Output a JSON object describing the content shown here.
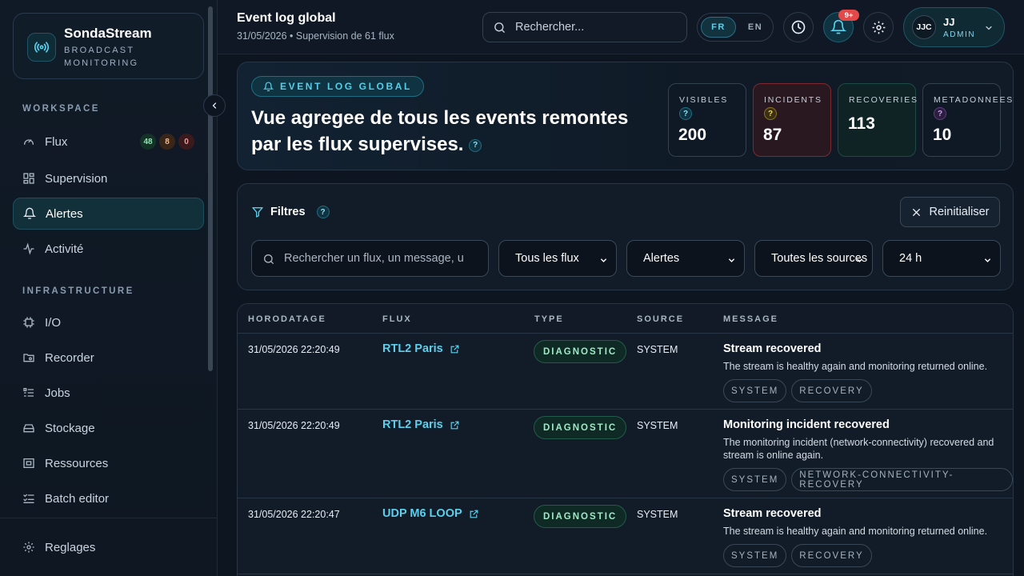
{
  "brand": {
    "name": "SondaStream",
    "subtitle": "BROADCAST MONITORING"
  },
  "sidebar": {
    "sections": {
      "workspace": "WORKSPACE",
      "infrastructure": "INFRASTRUCTURE"
    },
    "workspace_items": [
      {
        "label": "Flux",
        "icon": "gauge-icon"
      },
      {
        "label": "Supervision",
        "icon": "grid-icon"
      },
      {
        "label": "Alertes",
        "icon": "bell-icon",
        "active": true
      },
      {
        "label": "Activité",
        "icon": "activity-icon"
      }
    ],
    "flux_badges": {
      "ok": "48",
      "warn": "8",
      "error": "0"
    },
    "infrastructure_items": [
      {
        "label": "I/O",
        "icon": "chip-icon"
      },
      {
        "label": "Recorder",
        "icon": "folder-icon"
      },
      {
        "label": "Jobs",
        "icon": "list-icon"
      },
      {
        "label": "Stockage",
        "icon": "drive-icon"
      },
      {
        "label": "Ressources",
        "icon": "resources-icon"
      },
      {
        "label": "Batch editor",
        "icon": "checklist-icon"
      }
    ],
    "footer_item": {
      "label": "Reglages",
      "icon": "gear-icon"
    }
  },
  "topbar": {
    "title": "Event log global",
    "subtitle": "31/05/2026 • Supervision de 61 flux",
    "search_placeholder": "Rechercher...",
    "lang_active": "FR",
    "lang_other": "EN",
    "notif_count": "9+",
    "user": {
      "initials": "JJC",
      "name": "JJ",
      "role": "ADMIN"
    }
  },
  "hero": {
    "pill": "EVENT LOG GLOBAL",
    "title": "Vue agregee de tous les events remontes par les flux supervises.",
    "stats": [
      {
        "label": "VISIBLES",
        "value": "200"
      },
      {
        "label": "INCIDENTS",
        "value": "87"
      },
      {
        "label": "RECOVERIES",
        "value": "113"
      },
      {
        "label": "METADONNEES",
        "value": "10"
      }
    ]
  },
  "filters": {
    "title": "Filtres",
    "reset_label": "Reinitialiser",
    "search_placeholder": "Rechercher un flux, un message, u",
    "selects": [
      "Tous les flux",
      "Alertes",
      "Toutes les sources",
      "24 h"
    ]
  },
  "table": {
    "columns": [
      "HORODATAGE",
      "FLUX",
      "TYPE",
      "SOURCE",
      "MESSAGE"
    ],
    "rows": [
      {
        "date": "31/05/2026 22:20:49",
        "flux": "RTL2 Paris",
        "type": "DIAGNOSTIC",
        "source": "SYSTEM",
        "msg_title": "Stream recovered",
        "msg_body": "The stream is healthy again and monitoring returned online.",
        "tags": [
          "SYSTEM",
          "RECOVERY"
        ]
      },
      {
        "date": "31/05/2026 22:20:49",
        "flux": "RTL2 Paris",
        "type": "DIAGNOSTIC",
        "source": "SYSTEM",
        "msg_title": "Monitoring incident recovered",
        "msg_body": "The monitoring incident (network-connectivity) recovered and stream is online again.",
        "tags": [
          "SYSTEM",
          "NETWORK-CONNECTIVITY-RECOVERY"
        ]
      },
      {
        "date": "31/05/2026 22:20:47",
        "flux": "UDP M6 LOOP",
        "type": "DIAGNOSTIC",
        "source": "SYSTEM",
        "msg_title": "Stream recovered",
        "msg_body": "The stream is healthy again and monitoring returned online.",
        "tags": [
          "SYSTEM",
          "RECOVERY"
        ]
      }
    ]
  },
  "colors": {
    "accent": "#57cde9",
    "incident": "#7b2a32",
    "recovery": "#1d4a45",
    "background": "#0d1520"
  }
}
